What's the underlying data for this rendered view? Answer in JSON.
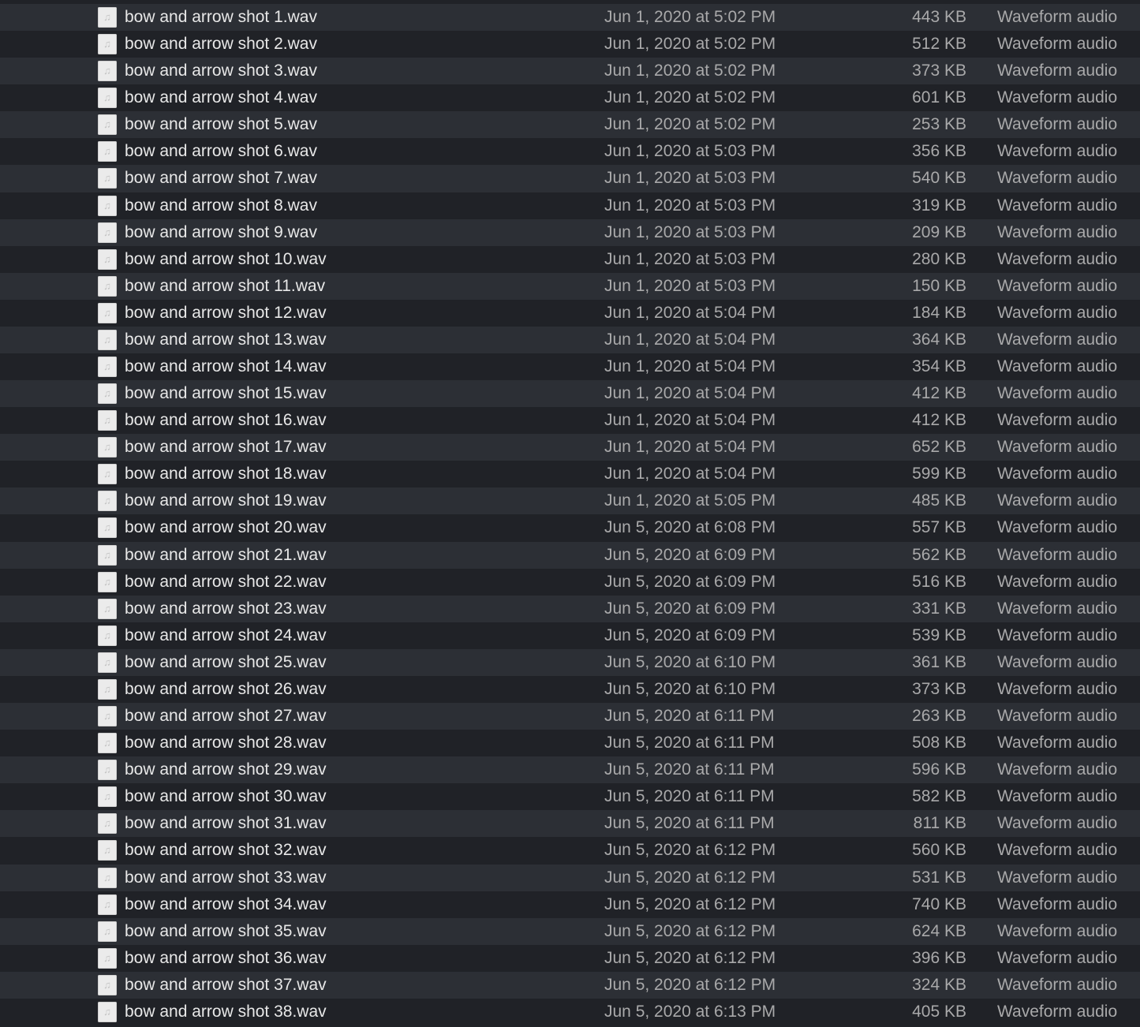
{
  "colors": {
    "row_light": "#2c2f35",
    "row_dark": "#202227",
    "name_text": "#e8e8e8",
    "secondary_text": "#a9a9aa"
  },
  "file_icon": "audio-file-icon",
  "files": [
    {
      "name": "bow and arrow shot 1.wav",
      "date": "Jun 1, 2020 at 5:02 PM",
      "size": "443 KB",
      "kind": "Waveform audio"
    },
    {
      "name": "bow and arrow shot 2.wav",
      "date": "Jun 1, 2020 at 5:02 PM",
      "size": "512 KB",
      "kind": "Waveform audio"
    },
    {
      "name": "bow and arrow shot 3.wav",
      "date": "Jun 1, 2020 at 5:02 PM",
      "size": "373 KB",
      "kind": "Waveform audio"
    },
    {
      "name": "bow and arrow shot 4.wav",
      "date": "Jun 1, 2020 at 5:02 PM",
      "size": "601 KB",
      "kind": "Waveform audio"
    },
    {
      "name": "bow and arrow shot 5.wav",
      "date": "Jun 1, 2020 at 5:02 PM",
      "size": "253 KB",
      "kind": "Waveform audio"
    },
    {
      "name": "bow and arrow shot 6.wav",
      "date": "Jun 1, 2020 at 5:03 PM",
      "size": "356 KB",
      "kind": "Waveform audio"
    },
    {
      "name": "bow and arrow shot 7.wav",
      "date": "Jun 1, 2020 at 5:03 PM",
      "size": "540 KB",
      "kind": "Waveform audio"
    },
    {
      "name": "bow and arrow shot 8.wav",
      "date": "Jun 1, 2020 at 5:03 PM",
      "size": "319 KB",
      "kind": "Waveform audio"
    },
    {
      "name": "bow and arrow shot 9.wav",
      "date": "Jun 1, 2020 at 5:03 PM",
      "size": "209 KB",
      "kind": "Waveform audio"
    },
    {
      "name": "bow and arrow shot 10.wav",
      "date": "Jun 1, 2020 at 5:03 PM",
      "size": "280 KB",
      "kind": "Waveform audio"
    },
    {
      "name": "bow and arrow shot 11.wav",
      "date": "Jun 1, 2020 at 5:03 PM",
      "size": "150 KB",
      "kind": "Waveform audio"
    },
    {
      "name": "bow and arrow shot 12.wav",
      "date": "Jun 1, 2020 at 5:04 PM",
      "size": "184 KB",
      "kind": "Waveform audio"
    },
    {
      "name": "bow and arrow shot 13.wav",
      "date": "Jun 1, 2020 at 5:04 PM",
      "size": "364 KB",
      "kind": "Waveform audio"
    },
    {
      "name": "bow and arrow shot 14.wav",
      "date": "Jun 1, 2020 at 5:04 PM",
      "size": "354 KB",
      "kind": "Waveform audio"
    },
    {
      "name": "bow and arrow shot 15.wav",
      "date": "Jun 1, 2020 at 5:04 PM",
      "size": "412 KB",
      "kind": "Waveform audio"
    },
    {
      "name": "bow and arrow shot 16.wav",
      "date": "Jun 1, 2020 at 5:04 PM",
      "size": "412 KB",
      "kind": "Waveform audio"
    },
    {
      "name": "bow and arrow shot 17.wav",
      "date": "Jun 1, 2020 at 5:04 PM",
      "size": "652 KB",
      "kind": "Waveform audio"
    },
    {
      "name": "bow and arrow shot 18.wav",
      "date": "Jun 1, 2020 at 5:04 PM",
      "size": "599 KB",
      "kind": "Waveform audio"
    },
    {
      "name": "bow and arrow shot 19.wav",
      "date": "Jun 1, 2020 at 5:05 PM",
      "size": "485 KB",
      "kind": "Waveform audio"
    },
    {
      "name": "bow and arrow shot 20.wav",
      "date": "Jun 5, 2020 at 6:08 PM",
      "size": "557 KB",
      "kind": "Waveform audio"
    },
    {
      "name": "bow and arrow shot 21.wav",
      "date": "Jun 5, 2020 at 6:09 PM",
      "size": "562 KB",
      "kind": "Waveform audio"
    },
    {
      "name": "bow and arrow shot 22.wav",
      "date": "Jun 5, 2020 at 6:09 PM",
      "size": "516 KB",
      "kind": "Waveform audio"
    },
    {
      "name": "bow and arrow shot 23.wav",
      "date": "Jun 5, 2020 at 6:09 PM",
      "size": "331 KB",
      "kind": "Waveform audio"
    },
    {
      "name": "bow and arrow shot 24.wav",
      "date": "Jun 5, 2020 at 6:09 PM",
      "size": "539 KB",
      "kind": "Waveform audio"
    },
    {
      "name": "bow and arrow shot 25.wav",
      "date": "Jun 5, 2020 at 6:10 PM",
      "size": "361 KB",
      "kind": "Waveform audio"
    },
    {
      "name": "bow and arrow shot 26.wav",
      "date": "Jun 5, 2020 at 6:10 PM",
      "size": "373 KB",
      "kind": "Waveform audio"
    },
    {
      "name": "bow and arrow shot 27.wav",
      "date": "Jun 5, 2020 at 6:11 PM",
      "size": "263 KB",
      "kind": "Waveform audio"
    },
    {
      "name": "bow and arrow shot 28.wav",
      "date": "Jun 5, 2020 at 6:11 PM",
      "size": "508 KB",
      "kind": "Waveform audio"
    },
    {
      "name": "bow and arrow shot 29.wav",
      "date": "Jun 5, 2020 at 6:11 PM",
      "size": "596 KB",
      "kind": "Waveform audio"
    },
    {
      "name": "bow and arrow shot 30.wav",
      "date": "Jun 5, 2020 at 6:11 PM",
      "size": "582 KB",
      "kind": "Waveform audio"
    },
    {
      "name": "bow and arrow shot 31.wav",
      "date": "Jun 5, 2020 at 6:11 PM",
      "size": "811 KB",
      "kind": "Waveform audio"
    },
    {
      "name": "bow and arrow shot 32.wav",
      "date": "Jun 5, 2020 at 6:12 PM",
      "size": "560 KB",
      "kind": "Waveform audio"
    },
    {
      "name": "bow and arrow shot 33.wav",
      "date": "Jun 5, 2020 at 6:12 PM",
      "size": "531 KB",
      "kind": "Waveform audio"
    },
    {
      "name": "bow and arrow shot 34.wav",
      "date": "Jun 5, 2020 at 6:12 PM",
      "size": "740 KB",
      "kind": "Waveform audio"
    },
    {
      "name": "bow and arrow shot 35.wav",
      "date": "Jun 5, 2020 at 6:12 PM",
      "size": "624 KB",
      "kind": "Waveform audio"
    },
    {
      "name": "bow and arrow shot 36.wav",
      "date": "Jun 5, 2020 at 6:12 PM",
      "size": "396 KB",
      "kind": "Waveform audio"
    },
    {
      "name": "bow and arrow shot 37.wav",
      "date": "Jun 5, 2020 at 6:12 PM",
      "size": "324 KB",
      "kind": "Waveform audio"
    },
    {
      "name": "bow and arrow shot 38.wav",
      "date": "Jun 5, 2020 at 6:13 PM",
      "size": "405 KB",
      "kind": "Waveform audio"
    }
  ]
}
